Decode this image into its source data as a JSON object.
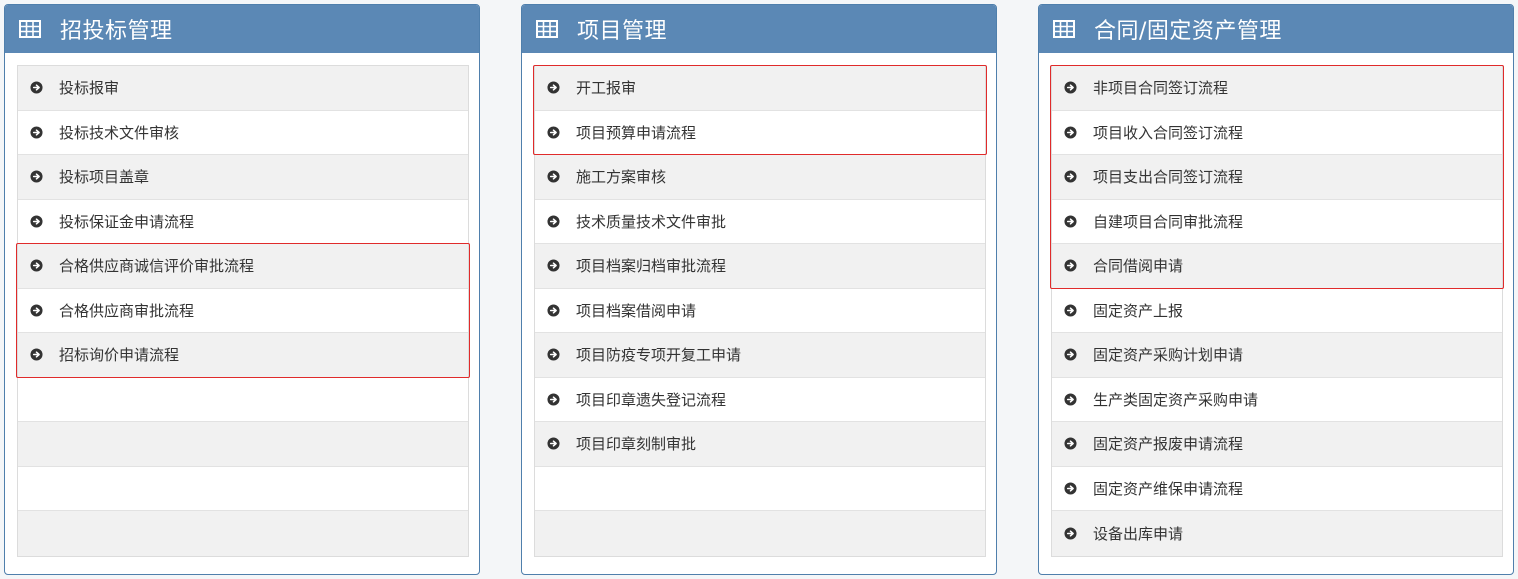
{
  "colors": {
    "header_bg": "#5b88b5",
    "panel_border": "#4f7fac",
    "highlight": "#e02b2b",
    "row_odd": "#f1f1f1",
    "row_even": "#ffffff"
  },
  "panels": [
    {
      "title": "招投标管理",
      "icon": "table-grid-icon",
      "items": [
        "投标报审",
        "投标技术文件审核",
        "投标项目盖章",
        "投标保证金申请流程",
        "合格供应商诚信评价审批流程",
        "合格供应商审批流程",
        "招标询价申请流程",
        "",
        "",
        "",
        ""
      ],
      "highlighted_items": [
        4,
        5,
        6
      ]
    },
    {
      "title": "项目管理",
      "icon": "table-grid-icon",
      "items": [
        "开工报审",
        " 项目预算申请流程",
        "施工方案审核",
        "技术质量技术文件审批",
        "项目档案归档审批流程",
        "项目档案借阅申请",
        "项目防疫专项开复工申请",
        "项目印章遗失登记流程",
        "项目印章刻制审批",
        "",
        ""
      ],
      "highlighted_items": [
        0,
        1
      ]
    },
    {
      "title": "合同/固定资产管理",
      "icon": "table-grid-icon",
      "items": [
        "非项目合同签订流程",
        "项目收入合同签订流程",
        "项目支出合同签订流程",
        "自建项目合同审批流程",
        "合同借阅申请",
        "固定资产上报",
        "固定资产采购计划申请",
        "生产类固定资产采购申请",
        "固定资产报废申请流程",
        "固定资产维保申请流程",
        "设备出库申请"
      ],
      "highlighted_items": [
        0,
        1,
        2,
        3,
        4
      ]
    }
  ]
}
